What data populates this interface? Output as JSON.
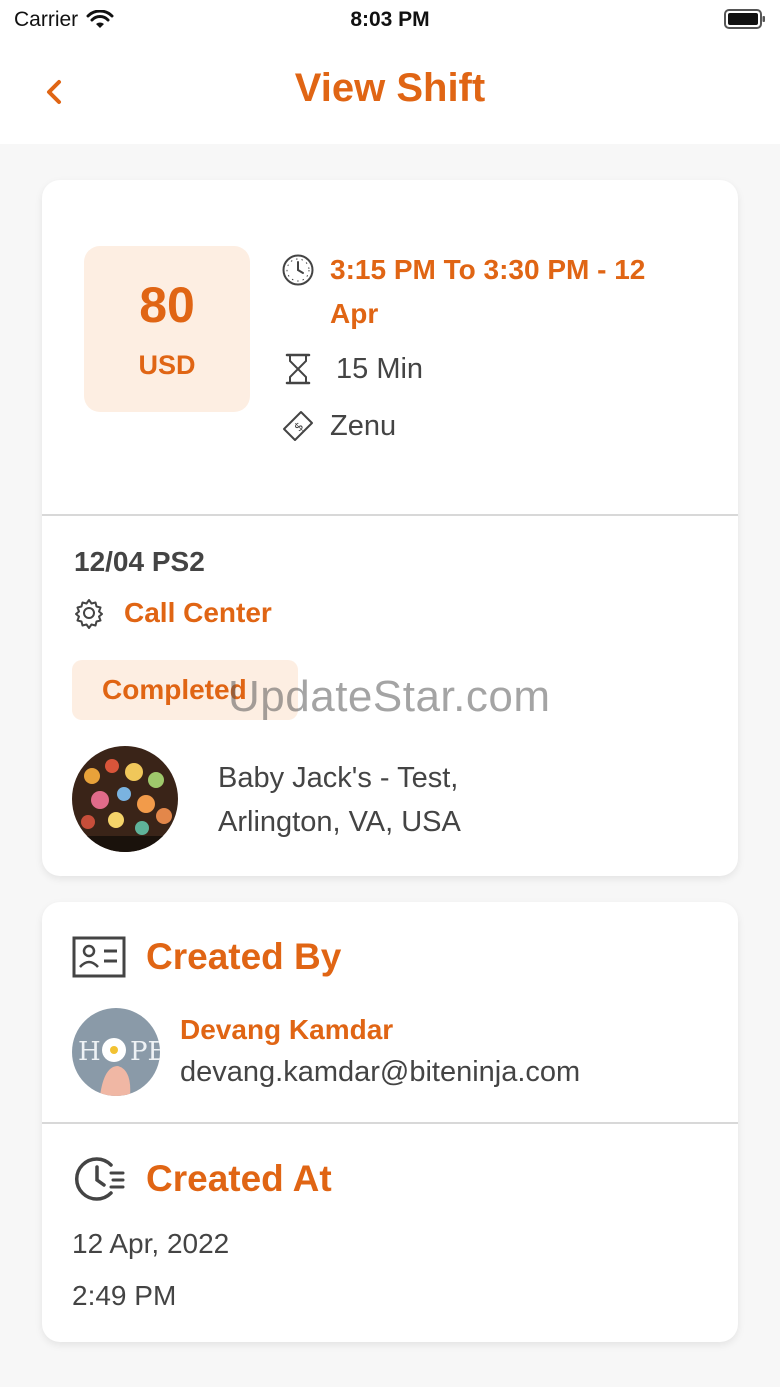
{
  "status_bar": {
    "carrier": "Carrier",
    "time": "8:03 PM"
  },
  "nav": {
    "title": "View Shift",
    "back_icon": "chevron-left-icon"
  },
  "shift": {
    "price_amount": "80",
    "price_currency": "USD",
    "time_range": "3:15 PM To 3:30 PM - 12 Apr",
    "duration": "15 Min",
    "company": "Zenu",
    "code": "12/04 PS2",
    "department": "Call Center",
    "status": "Completed",
    "location_line1": "Baby Jack's - Test,",
    "location_line2": "Arlington, VA, USA"
  },
  "created_by": {
    "title": "Created By",
    "name": "Devang Kamdar",
    "email": "devang.kamdar@biteninja.com"
  },
  "created_at": {
    "title": "Created At",
    "date": "12 Apr, 2022",
    "time": "2:49 PM"
  },
  "watermark": "UpdateStar.com",
  "colors": {
    "accent": "#e06514",
    "badge_bg": "#fdeee2",
    "page_bg": "#f7f7f7"
  }
}
